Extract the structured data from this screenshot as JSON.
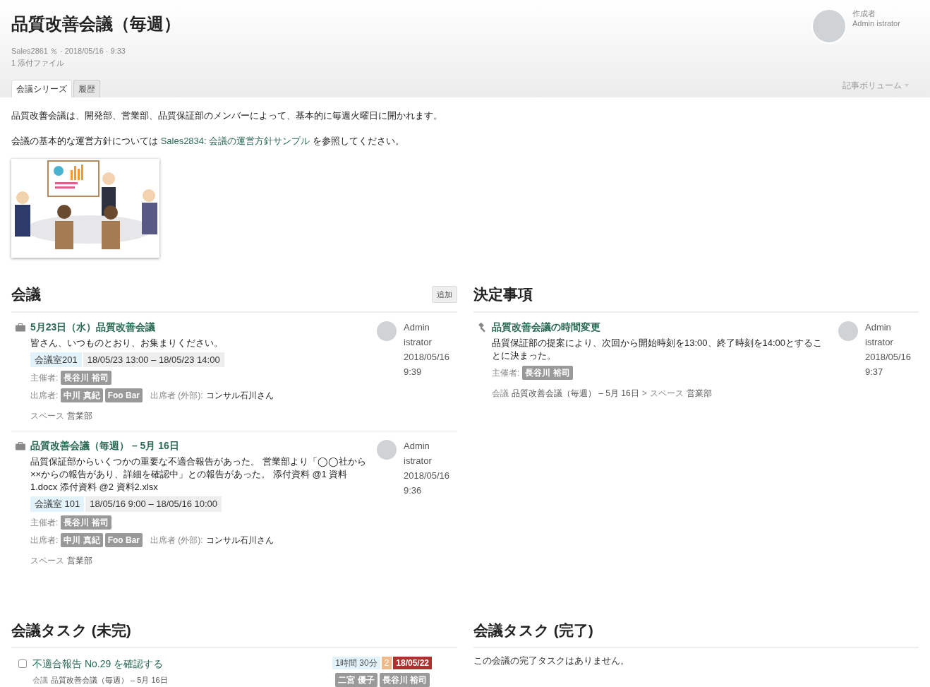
{
  "header": {
    "title": "品質改善会議（毎週）",
    "meta_id": "Sales2861",
    "meta_date": "· 2018/05/16 · 9:33",
    "attachments": "1 添付ファイル",
    "tabs": [
      {
        "label": "会議シリーズ",
        "selected": true
      },
      {
        "label": "履歴",
        "selected": false
      }
    ],
    "author": {
      "label": "作成者",
      "name": "Admin istrator"
    },
    "volume": "記事ボリューム"
  },
  "body": {
    "paragraph": "品質改善会議は、開発部、営業部、品質保証部のメンバーによって、基本的に毎週火曜日に開かれます。",
    "reference": {
      "before": "会議の基本的な運営方針については",
      "link": "Sales2834: 会議の運営方針サンプル",
      "after": "を参照してください。"
    }
  },
  "meetings": {
    "title": "会議",
    "add_button": "追加",
    "items": [
      {
        "title": "5月23日（水）品質改善会議",
        "body": "皆さん、いつものとおり、お集まりください。",
        "room": "会議室201",
        "time": "18/05/23 13:00 – 18/05/23 14:00",
        "organizer_label": "主催者:",
        "organizers": [
          "長谷川 裕司"
        ],
        "attendees_label": "出席者:",
        "attendees": [
          "中川 真紀",
          "Foo Bar"
        ],
        "external_label": "出席者 (外部):",
        "external": "コンサル石川さん",
        "space_label": "スペース",
        "space": "営業部",
        "author_lines": [
          "Admin",
          "istrator",
          "2018/05/16",
          "9:39"
        ]
      },
      {
        "title": "品質改善会議（毎週） – 5月 16日",
        "body": "品質保証部からいくつかの重要な不適合報告があった。 営業部より「◯◯社から××からの報告があり、詳細を確認中」との報告があった。 添付資料 @1 資料1.docx 添付資料 @2 資料2.xlsx",
        "room": "会議室 101",
        "time": "18/05/16 9:00 – 18/05/16 10:00",
        "organizer_label": "主催者:",
        "organizers": [
          "長谷川 裕司"
        ],
        "attendees_label": "出席者:",
        "attendees": [
          "中川 真紀",
          "Foo Bar"
        ],
        "external_label": "出席者 (外部):",
        "external": "コンサル石川さん",
        "space_label": "スペース",
        "space": "営業部",
        "author_lines": [
          "Admin",
          "istrator",
          "2018/05/16",
          "9:36"
        ]
      }
    ]
  },
  "decisions": {
    "title": "決定事項",
    "items": [
      {
        "title": "品質改善会議の時間変更",
        "body": "品質保証部の提案により、次回から開始時刻を13:00、終了時刻を14:00とすることに決まった。",
        "organizer_label": "主催者:",
        "organizers": [
          "長谷川 裕司"
        ],
        "meeting_label": "会議",
        "meeting": "品質改善会議（毎週） – 5月 16日",
        "separator": ">",
        "space_label": "スペース",
        "space": "営業部",
        "author_lines": [
          "Admin",
          "istrator",
          "2018/05/16",
          "9:37"
        ]
      }
    ]
  },
  "tasks_open": {
    "title": "会議タスク (未完)",
    "items": [
      {
        "checked": false,
        "title": "不適合報告 No.29 を確認する",
        "meeting_label": "会議",
        "meeting": "品質改善会議（毎週） – 5月 16日",
        "duration": "1時間 30分",
        "priority": "2",
        "due": "18/05/22",
        "assignees": [
          "二宮 優子",
          "長谷川 裕司"
        ]
      }
    ]
  },
  "tasks_done": {
    "title": "会議タスク (完了)",
    "empty": "この会議の完了タスクはありません。"
  }
}
